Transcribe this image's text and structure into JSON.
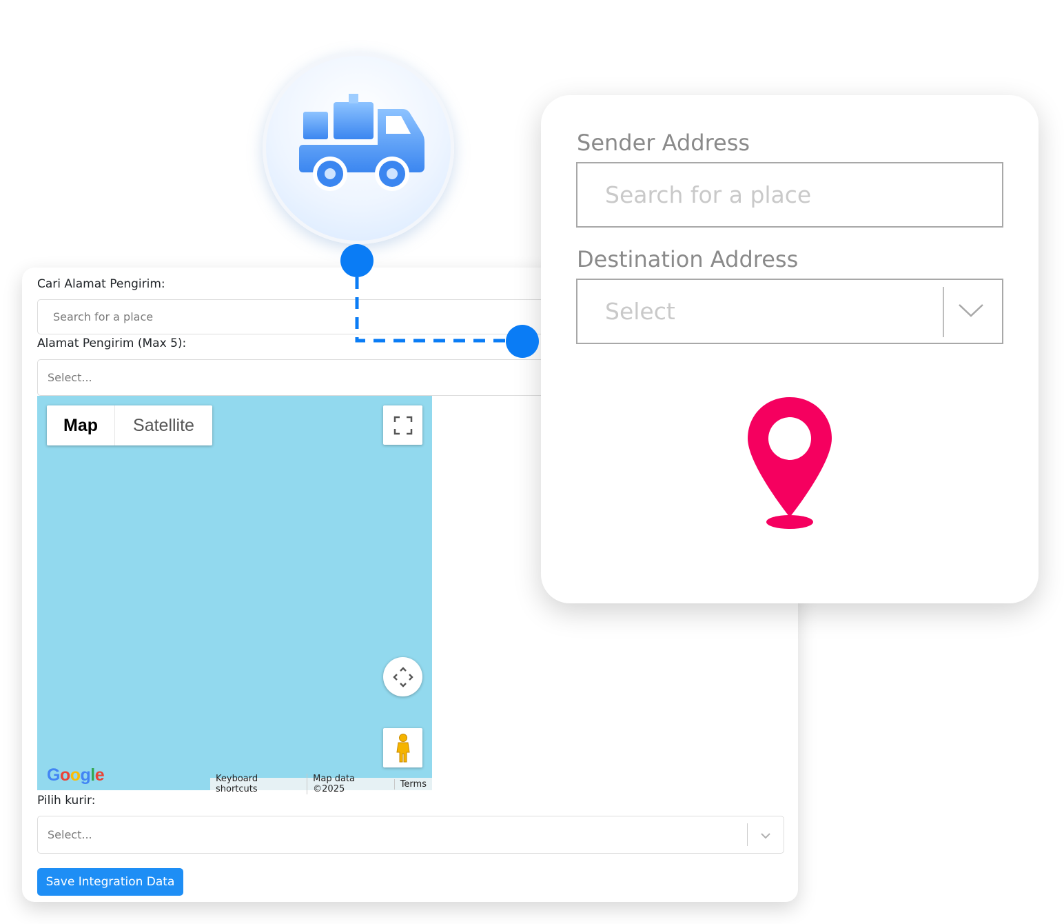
{
  "form": {
    "sender_search_label": "Cari Alamat Pengirim:",
    "sender_search_placeholder": "Search for a place",
    "sender_address_label": "Alamat Pengirim (Max 5):",
    "sender_address_placeholder": "Select...",
    "courier_label": "Pilih kurir:",
    "courier_placeholder": "Select...",
    "save_button": "Save Integration Data"
  },
  "map": {
    "type_map": "Map",
    "type_satellite": "Satellite",
    "logo": "Google",
    "keyboard_shortcuts": "Keyboard shortcuts",
    "map_data": "Map data ©2025",
    "terms": "Terms",
    "water_color": "#92d9ee"
  },
  "card": {
    "sender_label": "Sender Address",
    "sender_placeholder": "Search for a place",
    "destination_label": "Destination Address",
    "destination_placeholder": "Select",
    "pin_color": "#f5005f"
  },
  "icons": {
    "truck": "delivery-truck-icon",
    "pin": "location-pin-icon",
    "connector_color": "#0a7cf5"
  }
}
